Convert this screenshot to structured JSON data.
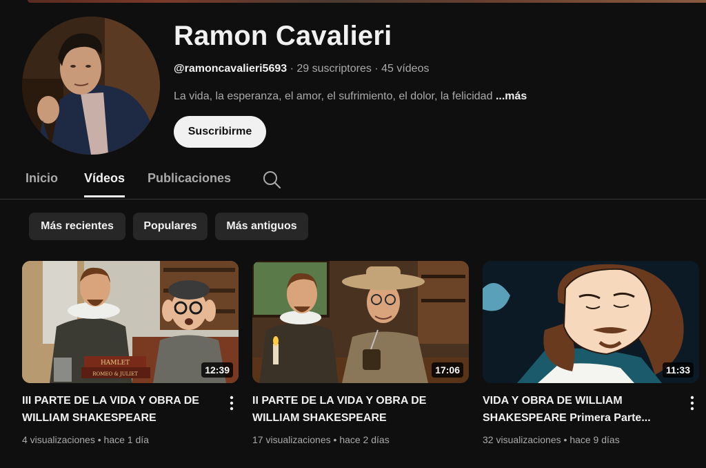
{
  "channel": {
    "name": "Ramon Cavalieri",
    "handle": "@ramoncavalieri5693",
    "subscribers": "29 suscriptores",
    "video_count": "45 vídeos",
    "separator": " · ",
    "description": "La vida, la esperanza, el amor, el sufrimiento, el dolor, la felicidad",
    "more_label": "...más",
    "subscribe_label": "Suscribirme"
  },
  "tabs": [
    {
      "label": "Inicio",
      "active": false
    },
    {
      "label": "Vídeos",
      "active": true
    },
    {
      "label": "Publicaciones",
      "active": false
    }
  ],
  "filters": [
    {
      "label": "Más recientes"
    },
    {
      "label": "Populares"
    },
    {
      "label": "Más antiguos"
    }
  ],
  "videos": [
    {
      "title": "III PARTE DE LA VIDA Y OBRA DE WILLIAM SHAKESPEARE",
      "duration": "12:39",
      "views": "4 visualizaciones",
      "age": "hace 1 día",
      "book_label_1": "HAMLET",
      "book_label_2": "ROMEO & JULIET"
    },
    {
      "title": "II PARTE DE LA VIDA Y OBRA DE WILLIAM SHAKESPEARE",
      "duration": "17:06",
      "views": "17 visualizaciones",
      "age": "hace 2 días"
    },
    {
      "title": "VIDA Y OBRA DE WILLIAM SHAKESPEARE Primera Parte...",
      "duration": "11:33",
      "views": "32 visualizaciones",
      "age": "hace 9 días"
    }
  ],
  "stat_separator": " • ",
  "colors": {
    "background": "#0f0f0f",
    "text_primary": "#f1f1f1",
    "text_secondary": "#aaaaaa",
    "chip_bg": "#272727",
    "subscribe_bg": "#f1f1f1"
  }
}
